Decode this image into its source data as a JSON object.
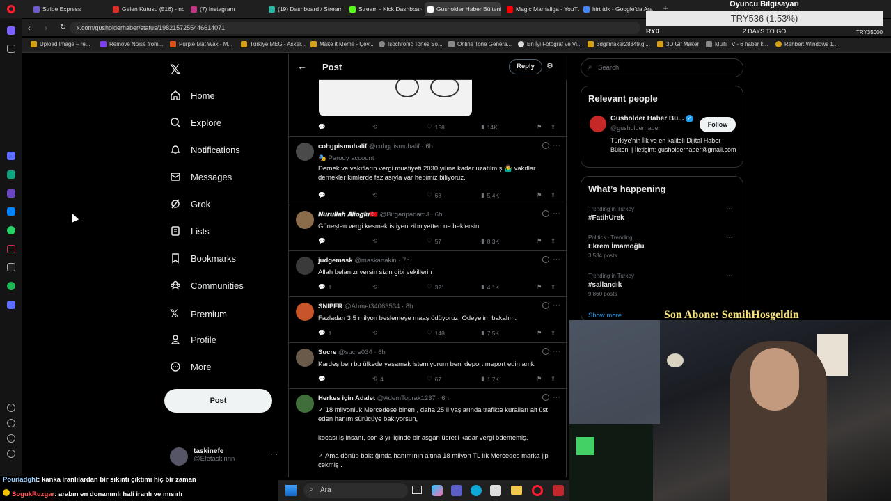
{
  "browser": {
    "tabs": [
      {
        "label": "Stripe Express",
        "color": "#6d5bd0"
      },
      {
        "label": "Gelen Kutusu (516) - nosc",
        "color": "#d93025"
      },
      {
        "label": "(7) Instagram",
        "color": "#c13584"
      },
      {
        "label": "(19) Dashboard / Streamla",
        "color": "#2db5a3"
      },
      {
        "label": "Stream - Kick Dashboard",
        "color": "#53fc18"
      },
      {
        "label": "Gusholder Haber Bülteni",
        "color": "#ffffff"
      },
      {
        "label": "Magic Mamaliga - YouTub",
        "color": "#ff0000"
      },
      {
        "label": "hirt tdk - Google'da Ara",
        "color": "#4285f4"
      }
    ],
    "url": "x.com/gusholderhaber/status/1982157255446614071",
    "bookmarks": [
      "Upload Image – re...",
      "Remove Noise from...",
      "Purple Mat Wax - M...",
      "Türkiye MEG - Asker...",
      "Make it Meme - Çev...",
      "Isochronic Tones So...",
      "Online Tone Genera...",
      "En İyi Fotoğraf ve Vi...",
      "3dgifmaker28349.gi...",
      "3D Gif Maker",
      "Multi TV - 6 haber k...",
      "Rehber: Windows 1..."
    ]
  },
  "overlay": {
    "title": "Oyuncu Bilgisayarı",
    "price": "TRY536 (1.53%)",
    "left_label": "RY0",
    "days": "2 DAYS TO GO",
    "right_label": "TRY35000"
  },
  "nav": {
    "home": "Home",
    "explore": "Explore",
    "notifications": "Notifications",
    "messages": "Messages",
    "grok": "Grok",
    "lists": "Lists",
    "bookmarks": "Bookmarks",
    "communities": "Communities",
    "premium": "Premium",
    "profile": "Profile",
    "more": "More",
    "post_button": "Post"
  },
  "account": {
    "name": "taskinefe",
    "handle": "@Efetaskinnn"
  },
  "header": {
    "title": "Post",
    "reply_button": "Reply"
  },
  "top_stats": {
    "likes": "158",
    "views": "14K"
  },
  "tweets": [
    {
      "name": "cohgpismuhalif",
      "handle": "@cohgpismuhalif",
      "time": "6h",
      "badge": "Parody account",
      "text": "Dernek ve vakıfların vergi muafiyeti 2030 yılına kadar uzatılmış 🤷‍♂️ vakıflar dernekler kimlerde fazlasıyla var hepimiz biliyoruz.",
      "replies": "",
      "retweets": "",
      "likes": "68",
      "views": "5.4K",
      "avatar": "#4a4a4a"
    },
    {
      "name": "𝑵𝒖𝒓𝒖𝒍𝒍𝒂𝒉 𝑨𝒍𝒊𝒐𝒈𝒍𝒖🇹🇷",
      "handle": "@BirgaripadamJ",
      "time": "6h",
      "badge": "",
      "text": "Güneşten vergi kesmek istiyen zihniyetten ne beklersin",
      "replies": "",
      "retweets": "",
      "likes": "57",
      "views": "8.3K",
      "avatar": "#8a6b4a"
    },
    {
      "name": "judgemask",
      "handle": "@maskanakin",
      "time": "7h",
      "badge": "",
      "text": "Allah belanızı versin sizin gibi vekillerin",
      "replies": "1",
      "retweets": "",
      "likes": "321",
      "views": "4.1K",
      "avatar": "#3a3a3a"
    },
    {
      "name": "SNIPER",
      "handle": "@Ahmet34063534",
      "time": "8h",
      "badge": "",
      "text": "Fazladan 3,5 milyon beslemeye maaş ödüyoruz. Ödeyelim bakalım.",
      "replies": "1",
      "retweets": "",
      "likes": "148",
      "views": "7.5K",
      "avatar": "#c8542a"
    },
    {
      "name": "Sucre",
      "handle": "@sucre034",
      "time": "6h",
      "badge": "",
      "text": "Kardeş ben bu ülkede yaşamak istemiyorum beni deport meport edin amk",
      "replies": "",
      "retweets": "4",
      "likes": "67",
      "views": "1.7K",
      "avatar": "#6a5a4a"
    },
    {
      "name": "Herkes için Adalet",
      "handle": "@AdemToprak1237",
      "time": "6h",
      "badge": "",
      "text": "✓ 18 milyonluk Mercedese binen , daha 25 li yaşlarında trafikte kuralları alt üst eden hanım sürücüye bakıyorsun,",
      "text2": "kocası iş insanı, son 3 yıl içinde bir asgari ücretli kadar vergi ödememiş.",
      "text3": "✓ Ama dönüp baktığında hanımının altına 18 milyon TL lık Mercedes marka jip çekmiş .",
      "avatar": "#3f6e3a"
    }
  ],
  "sidebar": {
    "search_placeholder": "Search",
    "relevant_title": "Relevant people",
    "person": {
      "name": "Gusholder Haber Bü...",
      "handle": "@gusholderhaber",
      "follow": "Follow",
      "bio": "Türkiye'nin İlk ve en kaliteli Dijital Haber Bülteni | İletişim: gusholderhaber@gmail.com"
    },
    "happening_title": "What’s happening",
    "trends": [
      {
        "context": "Trending in Turkey",
        "topic": "#FatihÜrek",
        "count": ""
      },
      {
        "context": "Politics · Trending",
        "topic": "Ekrem İmamoğlu",
        "count": "3,534 posts"
      },
      {
        "context": "Trending in Turkey",
        "topic": "#sallandık",
        "count": "9,860 posts"
      }
    ],
    "show_more": "Show more"
  },
  "stream": {
    "last_sub": "Son Abone: SemihHosgeldin",
    "chat": [
      {
        "user": "Pouriadght",
        "msg": ": kanka iranlılardan bir sıkıntı çıktımı hiç bir zaman"
      },
      {
        "user": "SogukRuzgar",
        "msg": ": arabın en donanımlı hali iranlı ve mısırlı"
      }
    ]
  },
  "taskbar": {
    "search": "Ara"
  }
}
